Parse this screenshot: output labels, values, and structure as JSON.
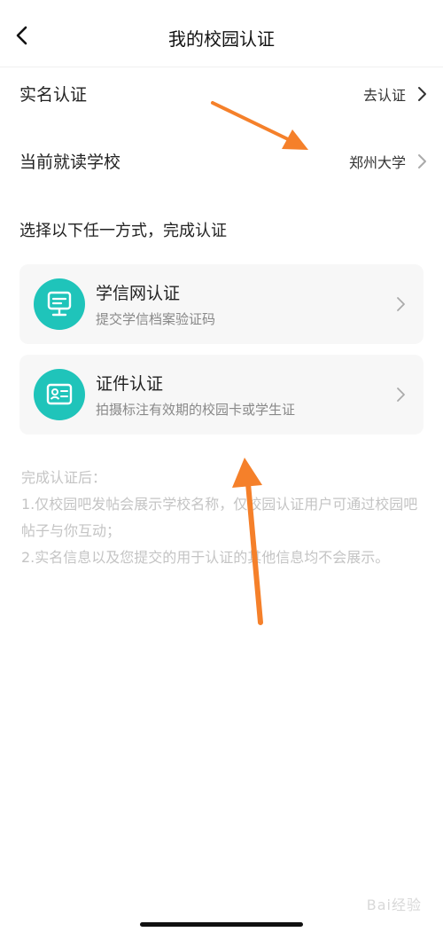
{
  "header": {
    "title": "我的校园认证"
  },
  "rows": {
    "real_name": {
      "label": "实名认证",
      "value": "去认证"
    },
    "school": {
      "label": "当前就读学校",
      "value": "郑州大学"
    }
  },
  "section_title": "选择以下任一方式，完成认证",
  "cards": [
    {
      "title": "学信网认证",
      "subtitle": "提交学信档案验证码",
      "icon": "monitor-icon"
    },
    {
      "title": "证件认证",
      "subtitle": "拍摄标注有效期的校园卡或学生证",
      "icon": "id-card-icon"
    }
  ],
  "notes": {
    "heading": "完成认证后：",
    "line1": "1.仅校园吧发帖会展示学校名称，仅校园认证用户可通过校园吧帖子与你互动；",
    "line2": "2.实名信息以及您提交的用于认证的其他信息均不会展示。"
  },
  "watermark": "Bai经验",
  "colors": {
    "accent": "#1fc4ba",
    "annotation": "#f5802a"
  }
}
